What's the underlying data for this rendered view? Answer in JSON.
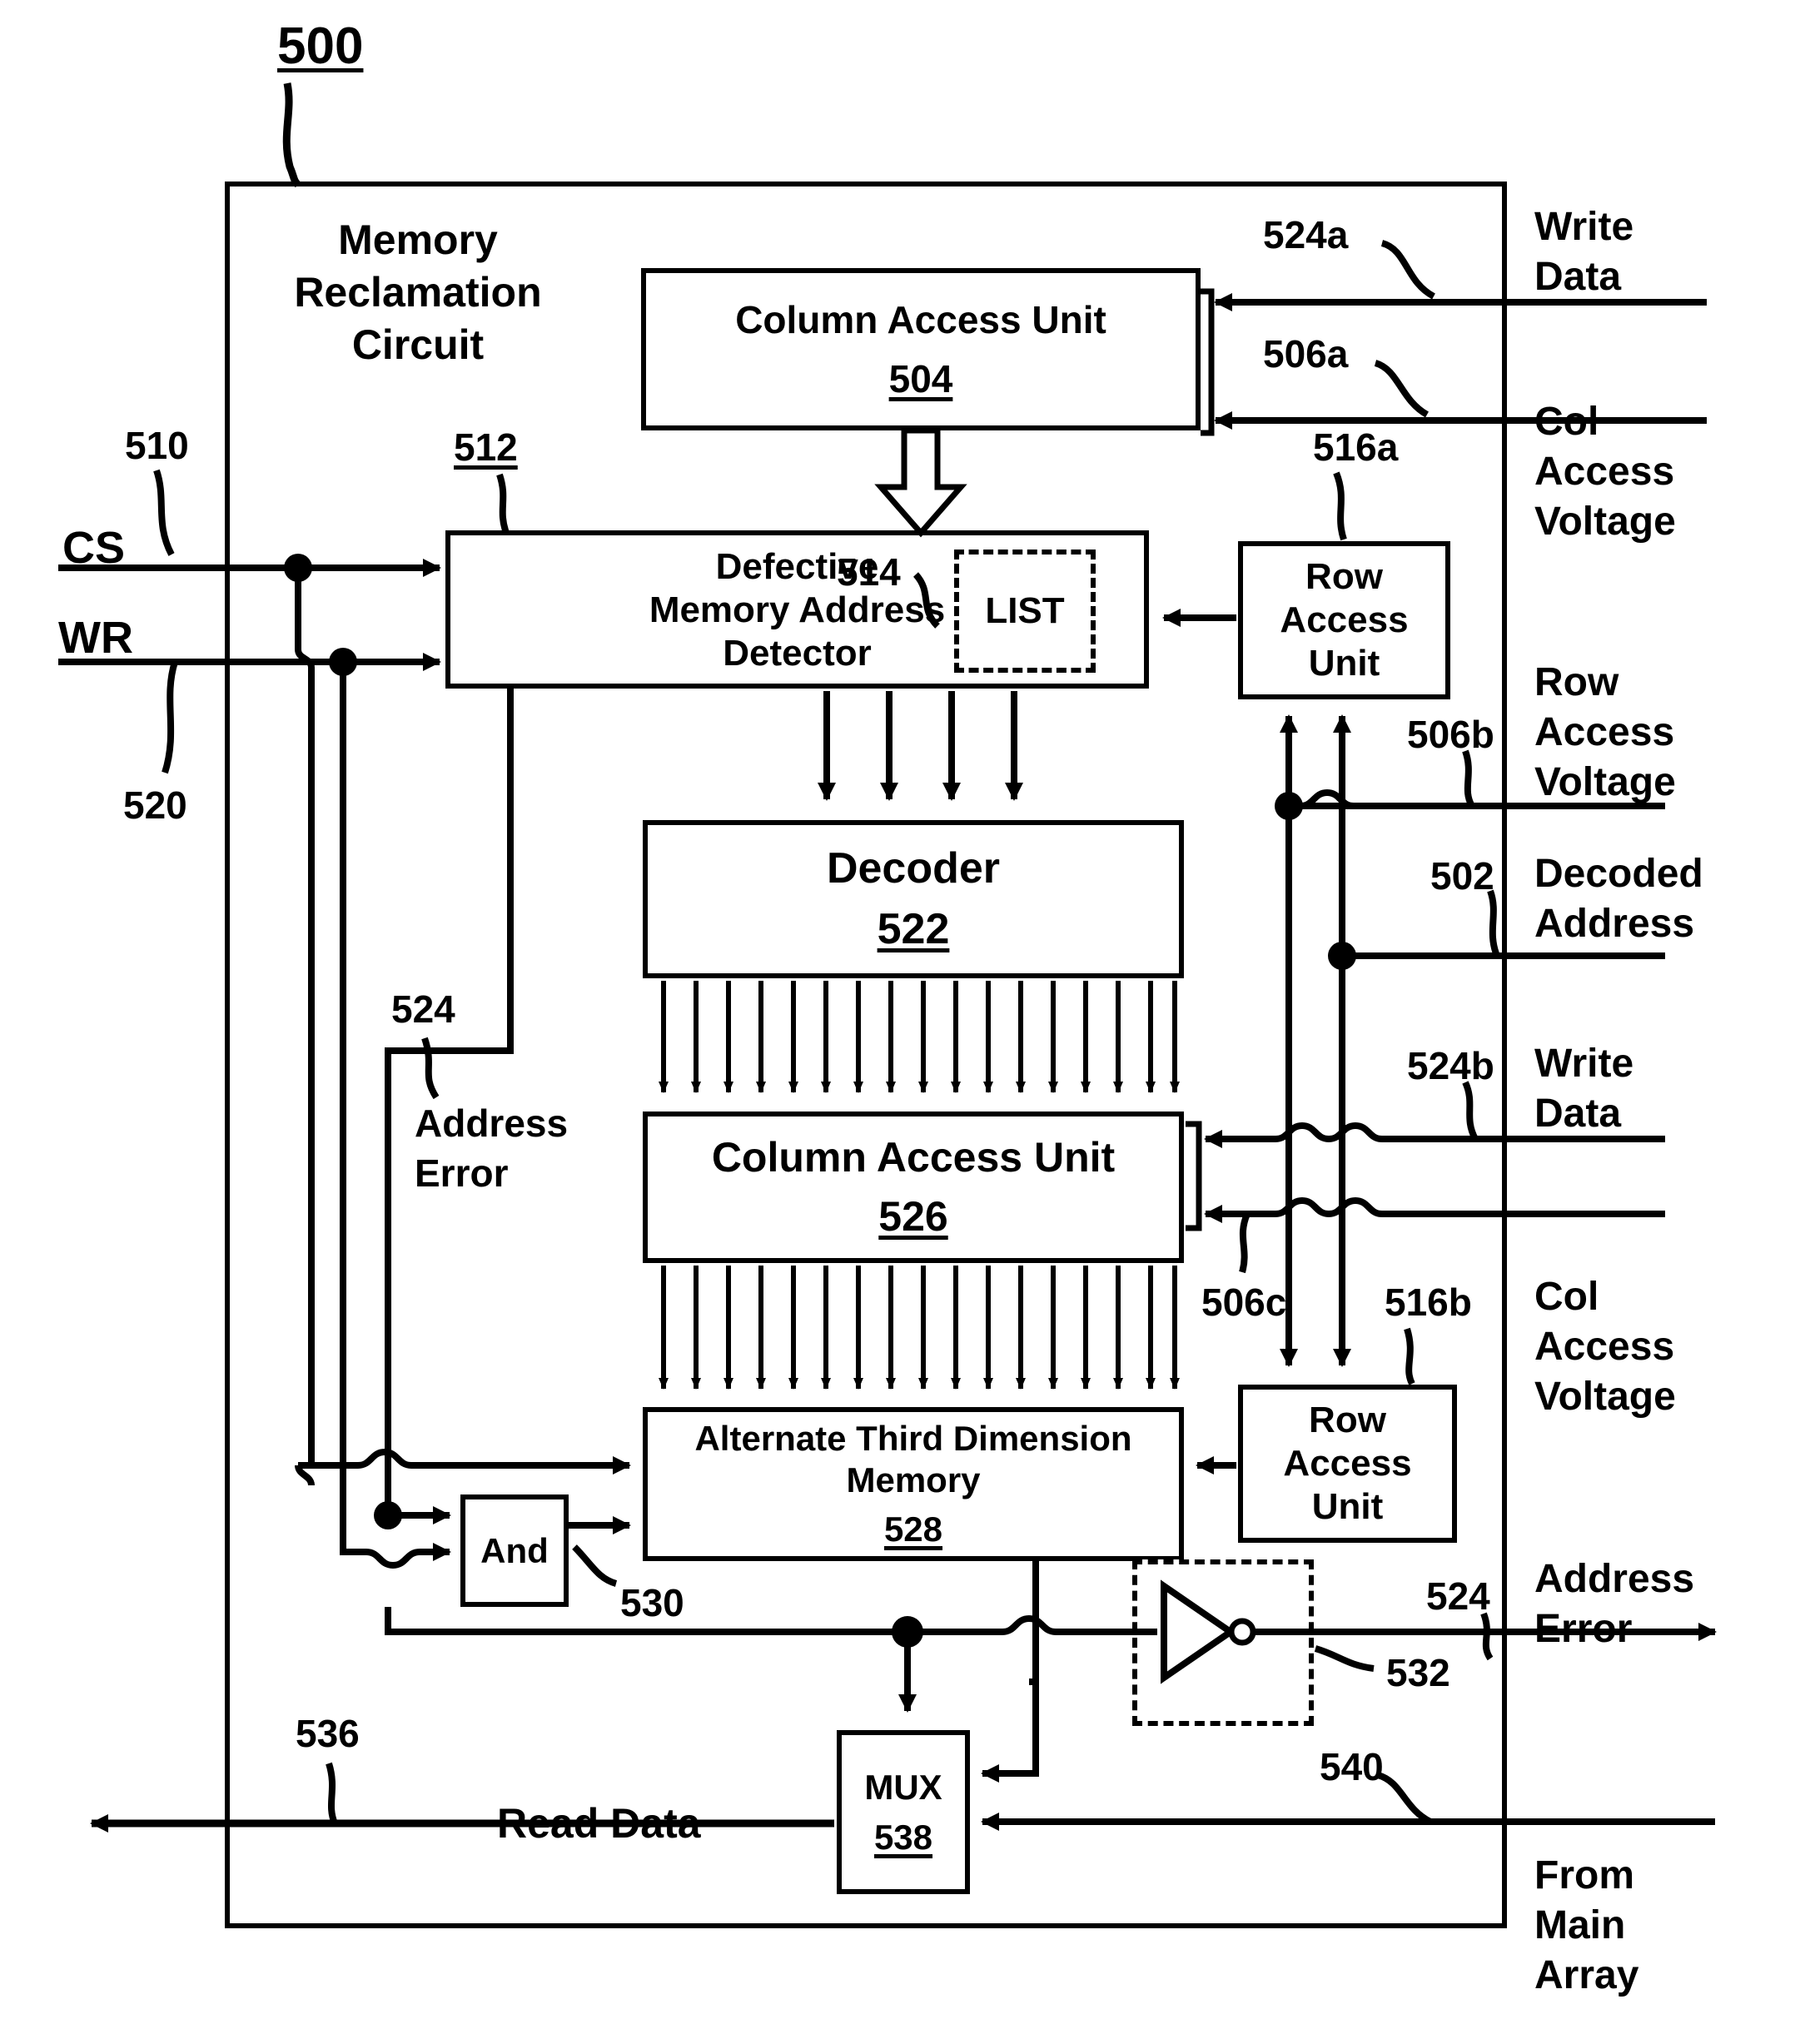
{
  "figure": {
    "number": "500",
    "circuit_title_line1": "Memory",
    "circuit_title_line2": "Reclamation",
    "circuit_title_line3": "Circuit"
  },
  "blocks": {
    "column_access_unit_top": {
      "label": "Column Access Unit",
      "number": "504"
    },
    "defective_detector": {
      "line1": "Defective",
      "line2": "Memory Address",
      "line3": "Detector",
      "number": "512",
      "list_ref": "514",
      "list_label": "LIST"
    },
    "row_access_unit_top": {
      "line1": "Row",
      "line2": "Access",
      "line3": "Unit",
      "number": "516a"
    },
    "row_access_unit_bottom": {
      "line1": "Row",
      "line2": "Access",
      "line3": "Unit",
      "number": "516b"
    },
    "decoder": {
      "label": "Decoder",
      "number": "522"
    },
    "column_access_unit_mid": {
      "label": "Column Access Unit",
      "number": "526"
    },
    "alternate_memory": {
      "line1": "Alternate Third Dimension",
      "line2": "Memory",
      "number": "528"
    },
    "and_gate": {
      "label": "And",
      "number": "530"
    },
    "inverter": {
      "number": "532"
    },
    "mux": {
      "label": "MUX",
      "number": "538"
    }
  },
  "signals": {
    "cs": {
      "name": "CS",
      "ref": "510"
    },
    "wr": {
      "name": "WR",
      "ref": "520"
    },
    "write_data_a": {
      "ref": "524a",
      "line1": "Write",
      "line2": "Data"
    },
    "col_access_voltage_a": {
      "ref": "506a",
      "line1": "Col",
      "line2": "Access",
      "line3": "Voltage"
    },
    "row_access_voltage_b": {
      "ref": "506b",
      "line1": "Row",
      "line2": "Access",
      "line3": "Voltage"
    },
    "decoded_address": {
      "ref": "502",
      "line1": "Decoded",
      "line2": "Address"
    },
    "write_data_b": {
      "ref": "524b",
      "line1": "Write",
      "line2": "Data"
    },
    "col_access_voltage_c": {
      "ref": "506c",
      "line1": "Col",
      "line2": "Access",
      "line3": "Voltage"
    },
    "address_error_internal": {
      "ref": "524",
      "line1": "Address",
      "line2": "Error"
    },
    "address_error_output": {
      "ref": "524",
      "line1": "Address",
      "line2": "Error"
    },
    "read_data": {
      "ref": "536",
      "label": "Read Data"
    },
    "from_main_array": {
      "ref": "540",
      "line1": "From",
      "line2": "Main",
      "line3": "Array"
    }
  }
}
